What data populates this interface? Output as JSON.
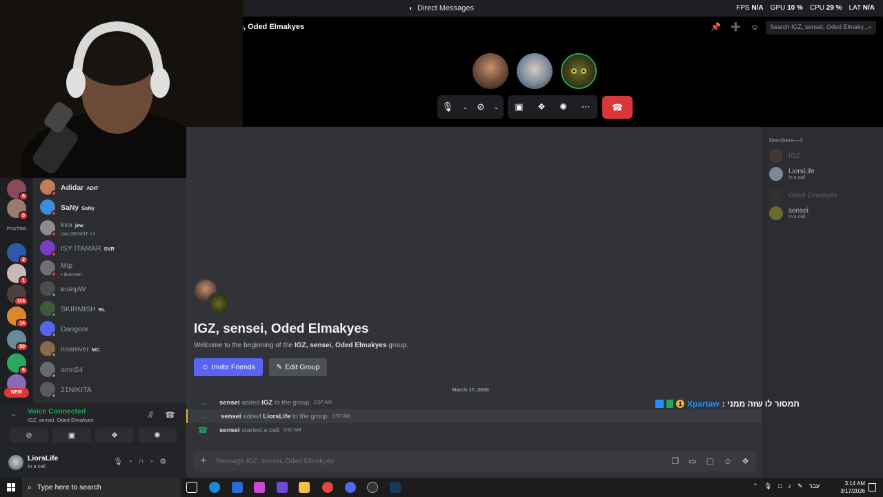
{
  "titlebar": {
    "title": "Direct Messages"
  },
  "perf": {
    "fps_label": "FPS",
    "fps_value": "N/A",
    "gpu_label": "GPU",
    "gpu_value": "10 %",
    "cpu_label": "CPU",
    "cpu_value": "29 %",
    "lat_label": "LAT",
    "lat_value": "N/A"
  },
  "call": {
    "channel_name": "i, Oded Elmakyes",
    "search_placeholder": "Search IGZ, sensei, Oded Elmaky..."
  },
  "dms": [
    {
      "name": "Adidar",
      "tag": "ADIF",
      "color": "#c27c5a",
      "status": "#f23f43",
      "strong": true
    },
    {
      "name": "SaNy",
      "tag": "SaNy",
      "color": "#3a8fd6",
      "status": "#f23f43",
      "strong": true
    },
    {
      "name": "kira",
      "tag": "jew",
      "sub": "VALORANT +1",
      "color": "#8c8c8c",
      "status": "#f23f43"
    },
    {
      "name": "ISY ITAMAR",
      "tag": "SVR",
      "color": "#7a3ec2",
      "status": "#f23f43"
    },
    {
      "name": "Mip",
      "sub": "• Batman",
      "color": "#6f6f6f",
      "status": "#f23f43"
    },
    {
      "name": "ɐuəʞɹW",
      "color": "#4d4d4d",
      "status": "#80848e"
    },
    {
      "name": "SKIRMISH",
      "tag": "RL",
      "color": "#3d5a3d",
      "status": "#23a55a"
    },
    {
      "name": "Dangoor",
      "color": "#5865f2",
      "status": "#80848e"
    },
    {
      "name": "noamver",
      "tag": "MC",
      "color": "#8a6a4a",
      "status": "#80848e"
    },
    {
      "name": "omri24",
      "color": "#6b6b6b",
      "status": "#80848e"
    },
    {
      "name": "21NIKITA",
      "color": "#5a5a5a",
      "status": "#80848e"
    }
  ],
  "rail": {
    "badges": [
      "6",
      "5",
      "2",
      "1",
      "114",
      "14",
      "50",
      "6"
    ],
    "text_label": "ממליצנית",
    "new_label": "NEW"
  },
  "voice": {
    "title": "Voice Connected",
    "sub": "IGZ, sensei, Oded Elmakyes",
    "user_name": "LiorsLife",
    "user_status": "In a call"
  },
  "chat": {
    "group_title": "IGZ, sensei, Oded Elmakyes",
    "welcome_prefix": "Welcome to the beginning of the ",
    "welcome_bold": "IGZ, sensei, Oded Elmakyes",
    "welcome_suffix": " group.",
    "invite_label": "Invite Friends",
    "edit_label": "Edit Group",
    "date": "March 17, 2026",
    "messages": [
      {
        "actor": "sensei",
        "verb": " added ",
        "target": "IGZ",
        "tail": " to the group.",
        "time": "2:57 AM"
      },
      {
        "actor": "sensei",
        "verb": " added ",
        "target": "LiorsLife",
        "tail": " to the group.",
        "time": "2:57 AM"
      },
      {
        "actor": "sensei",
        "verb": " started a call.",
        "target": "",
        "tail": "",
        "time": "3:02 AM"
      }
    ],
    "input_placeholder": "Message IGZ, sensei, Oded Elmakyes"
  },
  "members": {
    "header": "Members—4",
    "items": [
      {
        "name": "IGZ",
        "sub": "",
        "dim": true,
        "color": "#6a4a3a"
      },
      {
        "name": "LiorsLife",
        "sub": "In a call",
        "dim": false,
        "color": "#7a8a9a"
      },
      {
        "name": "Oded Elmakyes",
        "sub": "",
        "dim": true,
        "color": "#3a3a2a"
      },
      {
        "name": "sensei",
        "sub": "In a call",
        "dim": false,
        "color": "#6a6a2a"
      }
    ]
  },
  "overlay": {
    "user": "Xpartaw",
    "text": ": תמסור לו שזה ממני"
  },
  "taskbar": {
    "search_placeholder": "Type here to search",
    "time": "3:14 AM",
    "date": "3/17/2026",
    "lang": "עבר"
  },
  "colors": {
    "accent": "#5865f2",
    "danger": "#da373c",
    "online": "#23a55a"
  }
}
